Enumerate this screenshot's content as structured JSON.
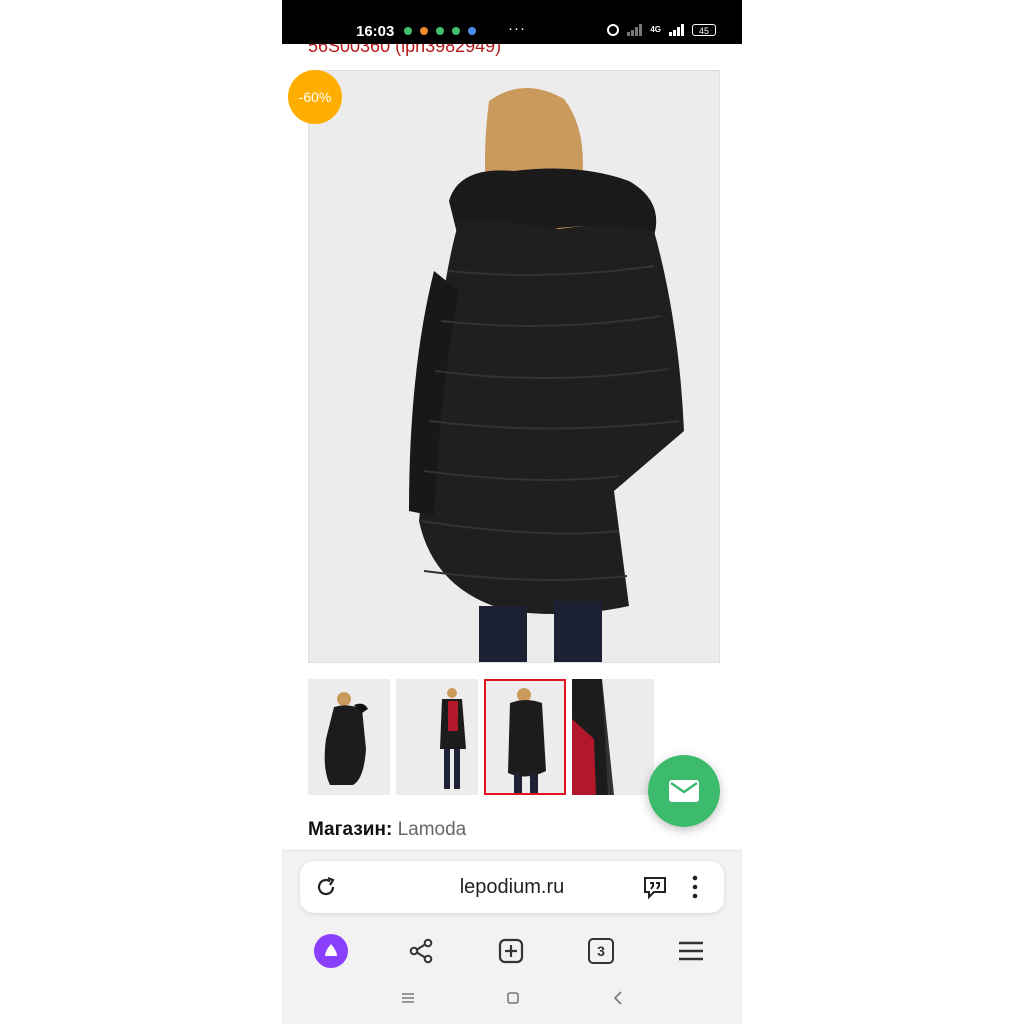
{
  "status_bar": {
    "time": "16:03",
    "more": "···",
    "network": "4G",
    "battery": "45"
  },
  "product": {
    "sku": "56S00360 (lpn3982949)",
    "discount_badge": "-60%",
    "store_label": "Магазин:",
    "store_value": "Lamoda",
    "thumbnails_selected_index": 2
  },
  "browser": {
    "url": "lepodium.ru",
    "tab_count": "3"
  },
  "colors": {
    "accent_red": "#b21a1a",
    "badge_orange": "#ffae00",
    "fab_green": "#3dbb6c",
    "alice_purple": "#8a3ffc"
  }
}
